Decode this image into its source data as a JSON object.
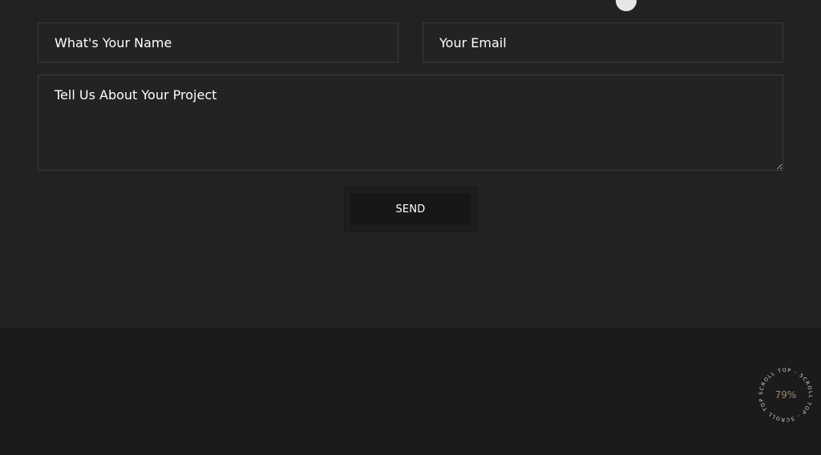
{
  "contact_form": {
    "name_placeholder": "What's Your Name",
    "email_placeholder": "Your Email",
    "message_placeholder": "Tell Us About Your Project",
    "send_label": "SEND"
  },
  "scroll_top": {
    "ring_text": "SCROLL TOP - SCROLL TOP - SCROLL TOP - ",
    "percent": "79%"
  },
  "colors": {
    "section_bg": "#222222",
    "footer_bg": "#1b1b1b",
    "field_border": "#3c3c3c",
    "button_bg": "#171717",
    "percent_accent": "#a08870"
  }
}
